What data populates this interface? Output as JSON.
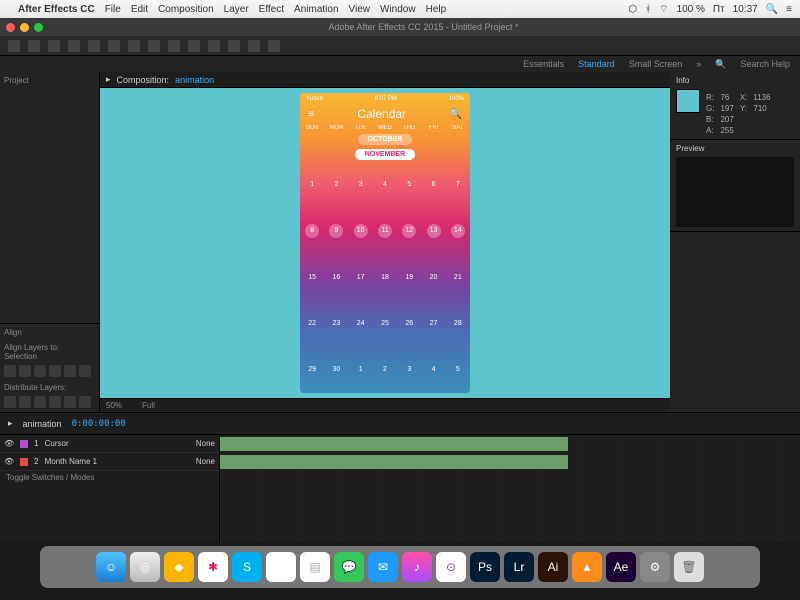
{
  "mac_menubar": {
    "app": "After Effects CC",
    "items": [
      "File",
      "Edit",
      "Composition",
      "Layer",
      "Effect",
      "Animation",
      "View",
      "Window",
      "Help"
    ],
    "battery": "100 %",
    "lang": "Пт",
    "clock": "10:37"
  },
  "titlebar": {
    "title": "Adobe After Effects CC 2015 - Untitled Project *"
  },
  "workspaces": {
    "items": [
      "Essentials",
      "Standard",
      "Small Screen"
    ],
    "active": "Standard",
    "search": "Search Help"
  },
  "panels": {
    "project": "Project",
    "align_title": "Align",
    "align_label": "Align Layers to:",
    "align_mode": "Selection",
    "distribute": "Distribute Layers:"
  },
  "comp": {
    "label": "Composition:",
    "name": "animation",
    "footer_zoom": "50%",
    "footer_res": "Full"
  },
  "info": {
    "title": "Info",
    "R": "76",
    "G": "197",
    "B": "207",
    "A": "255",
    "X": "1136",
    "Y": "710",
    "preview": "Preview"
  },
  "calendar": {
    "carrier": "Yuden",
    "time": "8:07 PM",
    "batt": "100%",
    "title": "Calendar",
    "days": [
      "SUN",
      "MON",
      "TUE",
      "WED",
      "THU",
      "FRI",
      "SAT"
    ],
    "oct": "OCTOBER",
    "nov": "NOVEMBER",
    "rows": [
      [
        "1",
        "2",
        "3",
        "4",
        "5",
        "6",
        "7"
      ],
      [
        "8",
        "9",
        "10",
        "11",
        "12",
        "13",
        "14"
      ],
      [
        "15",
        "16",
        "17",
        "18",
        "19",
        "20",
        "21"
      ],
      [
        "22",
        "23",
        "24",
        "25",
        "26",
        "27",
        "28"
      ],
      [
        "29",
        "30",
        "1",
        "2",
        "3",
        "4",
        "5"
      ]
    ]
  },
  "timeline": {
    "comp": "animation",
    "time": "0:00:00:00",
    "layers": [
      {
        "n": "1",
        "name": "Cursor",
        "mode": "None"
      },
      {
        "n": "2",
        "name": "Month Name 1",
        "mode": "None"
      }
    ],
    "toggle": "Toggle Switches / Modes"
  }
}
